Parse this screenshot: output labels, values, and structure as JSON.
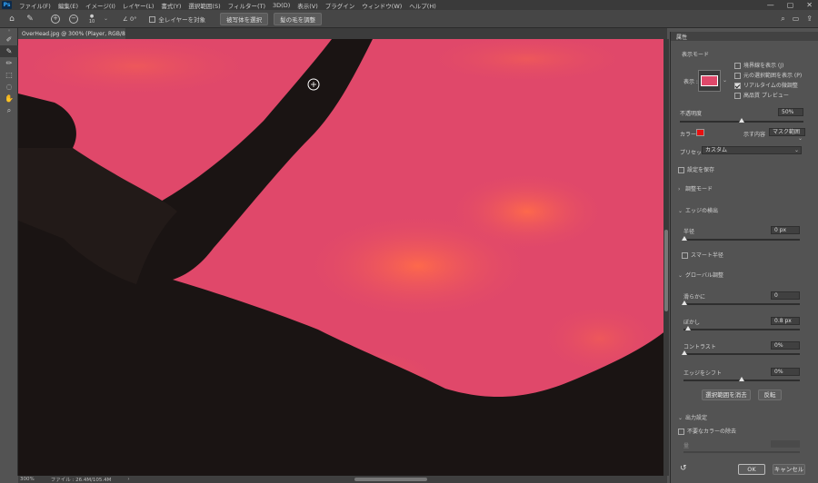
{
  "app": {
    "logo": "Ps"
  },
  "menu": [
    "ファイル(F)",
    "編集(E)",
    "イメージ(I)",
    "レイヤー(L)",
    "書式(Y)",
    "選択範囲(S)",
    "フィルター(T)",
    "3D(D)",
    "表示(V)",
    "プラグイン",
    "ウィンドウ(W)",
    "ヘルプ(H)"
  ],
  "options_bar": {
    "brush_size": "10",
    "angle": "0°",
    "sample_all_layers": "全レイヤーを対象",
    "select_subject": "被写体を選択",
    "refine_hair": "髪の毛を調整"
  },
  "document": {
    "tab_title": "OverHead.jpg @ 300% (Player, RGB/8) *",
    "zoom": "300%",
    "file_info": "ファイル : 26.4M/105.4M"
  },
  "colors": {
    "overlay": "#e0486a",
    "mask_color": "#e81010",
    "accent": "#31a8ff"
  },
  "panel": {
    "title": "属性",
    "view_mode": {
      "heading": "表示モード",
      "view_label": "表示 :",
      "show_edge": "境界線を表示 (J)",
      "show_original": "元の選択範囲を表示 (P)",
      "realtime": "リアルタイムの微調整",
      "hq_preview": "高品質 プレビュー"
    },
    "opacity_label": "不透明度",
    "opacity_value": "50%",
    "opacity_level": 0.5,
    "color_label": "カラー :",
    "indicates_label": "示す内容",
    "indicates_value": "マスク範囲",
    "preset_label": "プリセット :",
    "preset_value": "カスタム",
    "remember": "設定を保存",
    "adjust_mode": "調整モード",
    "edge_detection": "エッジの検出",
    "radius_label": "半径",
    "radius_value": "0 px",
    "smart_radius": "スマート半径",
    "global_refine": "グローバル調整",
    "smooth_label": "滑らかに",
    "smooth_value": "0",
    "feather_label": "ぼかし",
    "feather_value": "0.8 px",
    "contrast_label": "コントラスト",
    "contrast_value": "0%",
    "shift_label": "エッジをシフト",
    "shift_value": "0%",
    "clear_selection": "選択範囲を消去",
    "invert": "反転",
    "output_settings": "出力設定",
    "decontaminate": "不要なカラーの除去",
    "amount_label": "量",
    "ok": "OK",
    "cancel": "キャンセル"
  }
}
